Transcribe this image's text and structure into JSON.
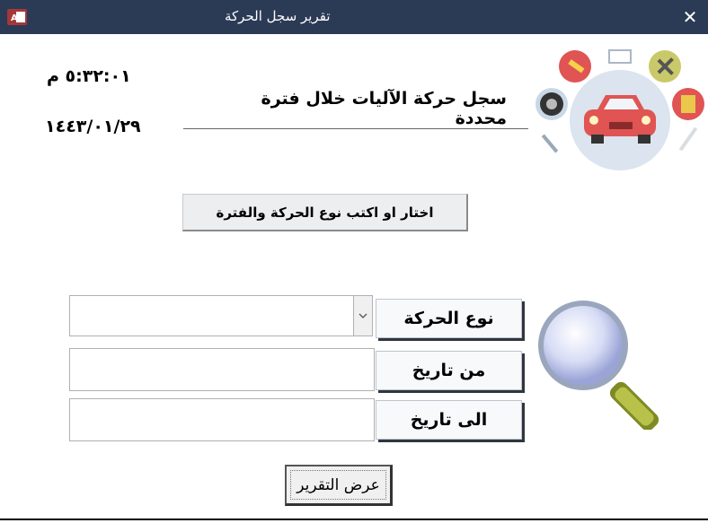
{
  "window": {
    "title": "تقرير سجل الحركة",
    "close_glyph": "✕"
  },
  "header": {
    "time": "٥:٣٢:٠١ م",
    "date": "١٤٤٣/٠١/٢٩",
    "heading": "سجل حركة الآليات خلال فترة محددة"
  },
  "hint_button": {
    "label": "اختار او اكتب نوع الحركة والفترة"
  },
  "form": {
    "movement_type_label": "نوع الحركة",
    "movement_type_value": "",
    "from_date_label": "من تاريخ",
    "from_date_value": "",
    "to_date_label": "الى تاريخ",
    "to_date_value": ""
  },
  "submit": {
    "label": "عرض التقرير"
  },
  "icons": {
    "app": "access-icon",
    "illustration": "car-service-icons",
    "magnifier": "magnifier-icon"
  }
}
